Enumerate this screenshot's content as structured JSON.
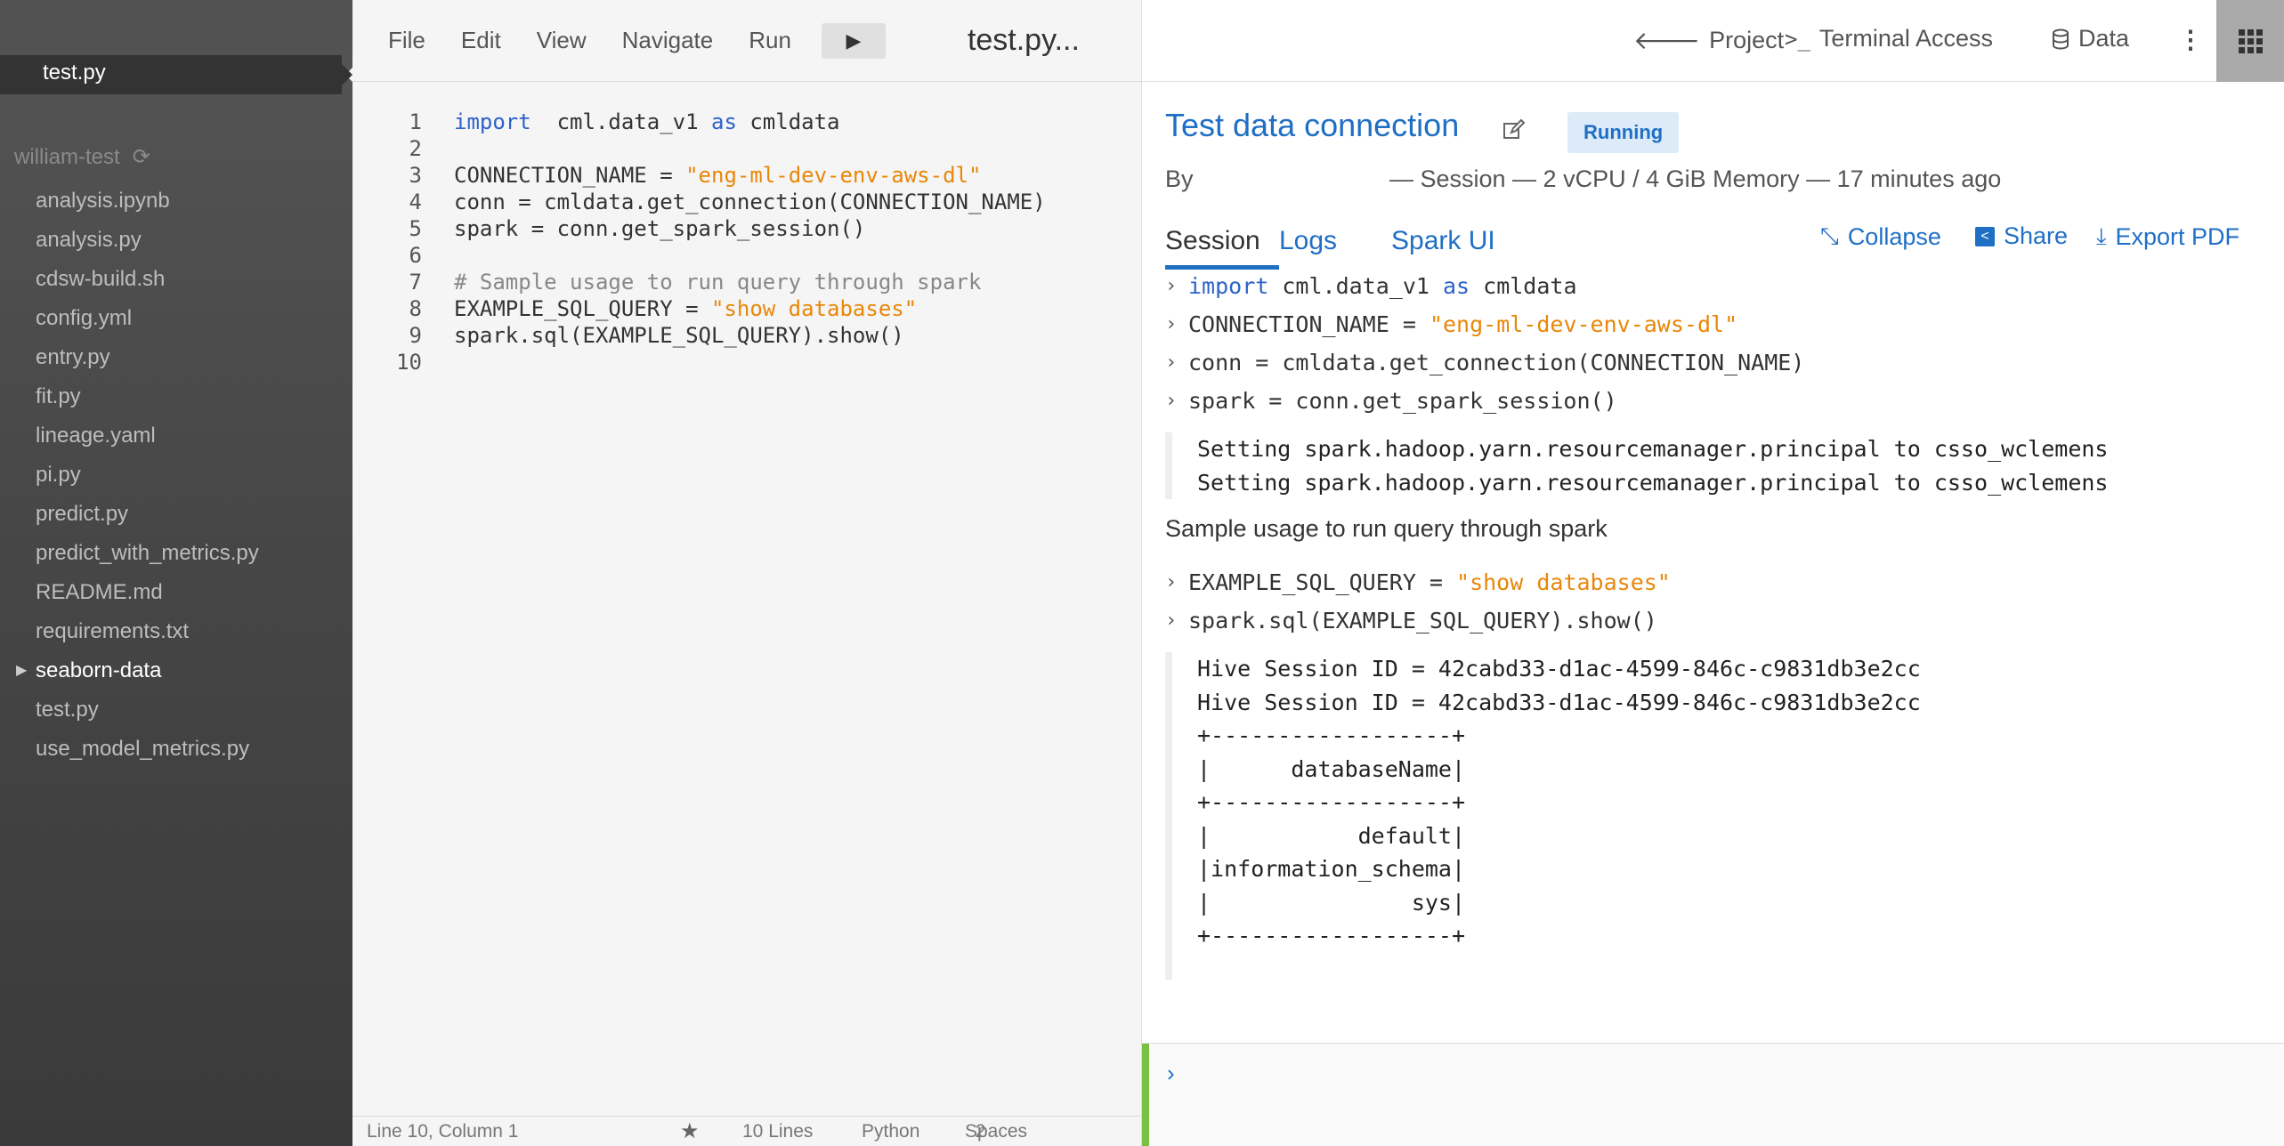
{
  "sidebar": {
    "active_file": "test.py",
    "project_name": "william-test",
    "files": [
      {
        "name": "analysis.ipynb",
        "type": "file"
      },
      {
        "name": "analysis.py",
        "type": "file"
      },
      {
        "name": "cdsw-build.sh",
        "type": "file"
      },
      {
        "name": "config.yml",
        "type": "file"
      },
      {
        "name": "entry.py",
        "type": "file"
      },
      {
        "name": "fit.py",
        "type": "file"
      },
      {
        "name": "lineage.yaml",
        "type": "file"
      },
      {
        "name": "pi.py",
        "type": "file"
      },
      {
        "name": "predict.py",
        "type": "file"
      },
      {
        "name": "predict_with_metrics.py",
        "type": "file"
      },
      {
        "name": "README.md",
        "type": "file"
      },
      {
        "name": "requirements.txt",
        "type": "file"
      },
      {
        "name": "seaborn-data",
        "type": "folder"
      },
      {
        "name": "test.py",
        "type": "file"
      },
      {
        "name": "use_model_metrics.py",
        "type": "file"
      }
    ]
  },
  "editor": {
    "menu": [
      "File",
      "Edit",
      "View",
      "Navigate",
      "Run"
    ],
    "run_icon": "play-icon",
    "file_title": "test.py...",
    "code_lines": [
      [
        "1",
        [
          [
            "kw",
            "import"
          ],
          [
            "",
            "  cml.data_v1 "
          ],
          [
            "kw",
            "as"
          ],
          [
            "",
            " cmldata"
          ]
        ]
      ],
      [
        "2",
        []
      ],
      [
        "3",
        [
          [
            "",
            "CONNECTION_NAME = "
          ],
          [
            "str",
            "\"eng-ml-dev-env-aws-dl\""
          ]
        ]
      ],
      [
        "4",
        [
          [
            "",
            "conn = cmldata.get_connection(CONNECTION_NAME)"
          ]
        ]
      ],
      [
        "5",
        [
          [
            "",
            "spark = conn.get_spark_session()"
          ]
        ]
      ],
      [
        "6",
        []
      ],
      [
        "7",
        [
          [
            "cm",
            "# Sample usage to run query through spark"
          ]
        ]
      ],
      [
        "8",
        [
          [
            "",
            "EXAMPLE_SQL_QUERY = "
          ],
          [
            "str",
            "\"show databases\""
          ]
        ]
      ],
      [
        "9",
        [
          [
            "",
            "spark.sql(EXAMPLE_SQL_QUERY).show()"
          ]
        ]
      ],
      [
        "10",
        []
      ]
    ],
    "status": {
      "position": "Line 10, Column 1",
      "star_icon": "star-icon",
      "lines": "10 Lines",
      "language": "Python",
      "spaces_label": "Spaces",
      "spaces_value": "2"
    }
  },
  "topnav": {
    "project": "Project",
    "terminal": "Terminal Access",
    "data": "Data"
  },
  "session": {
    "title": "Test data connection",
    "status": "Running",
    "by_label": "By",
    "meta": "— Session — 2 vCPU / 4 GiB Memory — 17 minutes ago",
    "tabs": [
      "Session",
      "Logs",
      "Spark UI"
    ],
    "active_tab": "Session",
    "actions": {
      "collapse": "Collapse",
      "share": "Share",
      "export": "Export PDF"
    }
  },
  "output": {
    "inputs_a": [
      [
        [
          "kw",
          "import"
        ],
        [
          "",
          " cml.data_v1 "
        ],
        [
          "kw",
          "as"
        ],
        [
          "",
          " cmldata"
        ]
      ],
      [
        [
          "",
          "CONNECTION_NAME = "
        ],
        [
          "str",
          "\"eng-ml-dev-env-aws-dl\""
        ]
      ],
      [
        [
          "",
          "conn = cmldata.get_connection(CONNECTION_NAME)"
        ]
      ],
      [
        [
          "",
          "spark = conn.get_spark_session()"
        ]
      ]
    ],
    "block_a": [
      "Setting spark.hadoop.yarn.resourcemanager.principal to csso_wclemens",
      "Setting spark.hadoop.yarn.resourcemanager.principal to csso_wclemens"
    ],
    "markdown": "Sample usage to run query through spark",
    "inputs_b": [
      [
        [
          "",
          "EXAMPLE_SQL_QUERY = "
        ],
        [
          "str",
          "\"show databases\""
        ]
      ],
      [
        [
          "",
          "spark.sql(EXAMPLE_SQL_QUERY).show()"
        ]
      ]
    ],
    "block_b": [
      "Hive Session ID = 42cabd33-d1ac-4599-846c-c9831db3e2cc",
      "Hive Session ID = 42cabd33-d1ac-4599-846c-c9831db3e2cc",
      "+------------------+",
      "|      databaseName|",
      "+------------------+",
      "|           default|",
      "|information_schema|",
      "|               sys|",
      "+------------------+"
    ]
  },
  "console": {
    "prompt": ">"
  }
}
